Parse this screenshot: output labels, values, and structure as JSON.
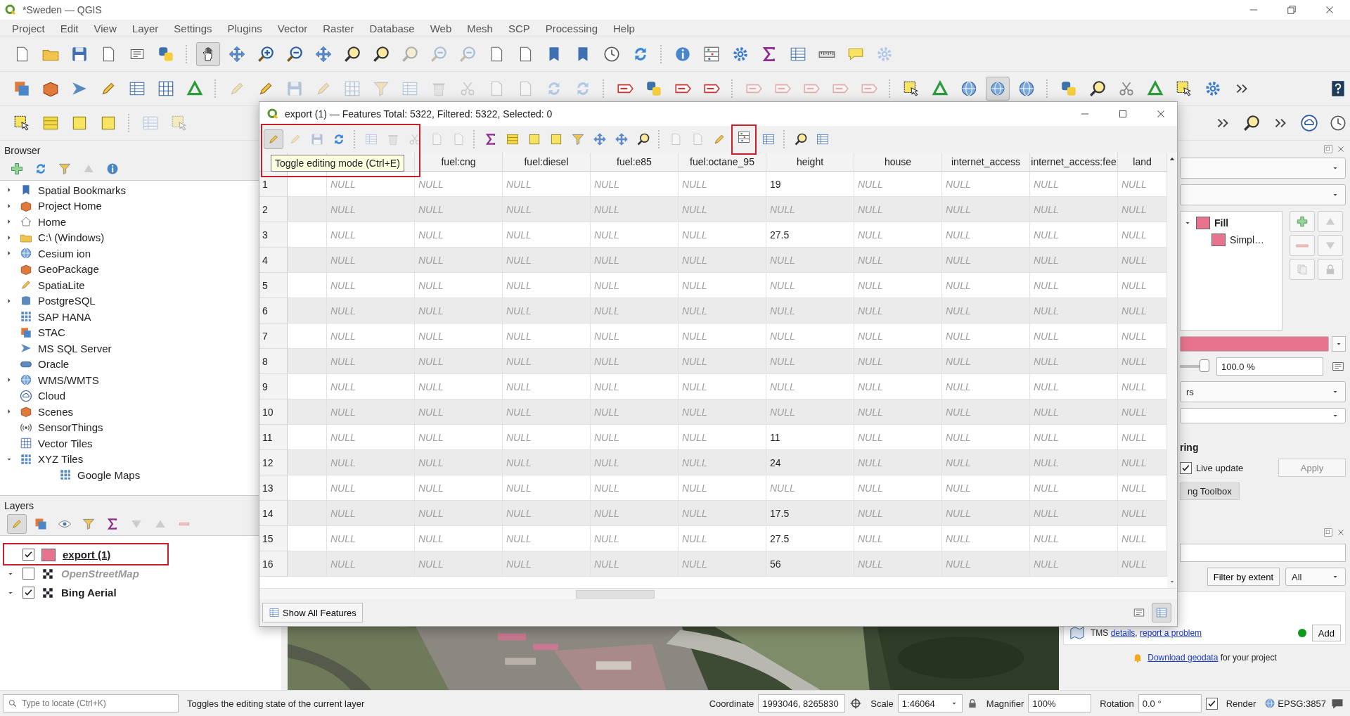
{
  "window": {
    "title": "*Sweden — QGIS"
  },
  "menu": [
    "Project",
    "Edit",
    "View",
    "Layer",
    "Settings",
    "Plugins",
    "Vector",
    "Raster",
    "Database",
    "Web",
    "Mesh",
    "SCP",
    "Processing",
    "Help"
  ],
  "browser": {
    "title": "Browser",
    "items": [
      {
        "label": "Spatial Bookmarks",
        "expandable": true,
        "expanded": false
      },
      {
        "label": "Project Home",
        "expandable": true,
        "expanded": false
      },
      {
        "label": "Home",
        "expandable": true,
        "expanded": false
      },
      {
        "label": "C:\\ (Windows)",
        "expandable": true,
        "expanded": false
      },
      {
        "label": "Cesium ion",
        "expandable": true,
        "expanded": false
      },
      {
        "label": "GeoPackage",
        "expandable": false
      },
      {
        "label": "SpatiaLite",
        "expandable": false
      },
      {
        "label": "PostgreSQL",
        "expandable": true,
        "expanded": false
      },
      {
        "label": "SAP HANA",
        "expandable": false
      },
      {
        "label": "STAC",
        "expandable": false
      },
      {
        "label": "MS SQL Server",
        "expandable": false
      },
      {
        "label": "Oracle",
        "expandable": false
      },
      {
        "label": "WMS/WMTS",
        "expandable": true,
        "expanded": false
      },
      {
        "label": "Cloud",
        "expandable": false
      },
      {
        "label": "Scenes",
        "expandable": true,
        "expanded": false
      },
      {
        "label": "SensorThings",
        "expandable": false
      },
      {
        "label": "Vector Tiles",
        "expandable": false
      },
      {
        "label": "XYZ Tiles",
        "expandable": true,
        "expanded": true,
        "children": [
          {
            "label": "Google Maps"
          }
        ]
      }
    ]
  },
  "layers": {
    "title": "Layers",
    "items": [
      {
        "name": "export (1)",
        "kind": "vector",
        "visible": true,
        "current": true
      },
      {
        "name": "OpenStreetMap",
        "kind": "raster",
        "visible": false,
        "current": false,
        "expanded": true
      },
      {
        "name": "Bing Aerial",
        "kind": "group",
        "visible": true,
        "current": false,
        "expanded": true
      }
    ]
  },
  "attribute_table": {
    "title": "export (1) — Features Total: 5322, Filtered: 5322, Selected: 0",
    "tooltip": "Toggle editing mode (Ctrl+E)",
    "columns": [
      "",
      "fuel:cng",
      "fuel:diesel",
      "fuel:e85",
      "fuel:octane_95",
      "height",
      "house",
      "internet_access",
      "internet_access:fee",
      "land"
    ],
    "rows": [
      {
        "number": "1",
        "cells": [
          "NULL",
          "NULL",
          "NULL",
          "NULL",
          "NULL",
          "19",
          "NULL",
          "NULL",
          "NULL",
          "NULL"
        ]
      },
      {
        "number": "2",
        "cells": [
          "NULL",
          "NULL",
          "NULL",
          "NULL",
          "NULL",
          "NULL",
          "NULL",
          "NULL",
          "NULL",
          "NULL"
        ]
      },
      {
        "number": "3",
        "cells": [
          "NULL",
          "NULL",
          "NULL",
          "NULL",
          "NULL",
          "27.5",
          "NULL",
          "NULL",
          "NULL",
          "NULL"
        ]
      },
      {
        "number": "4",
        "cells": [
          "NULL",
          "NULL",
          "NULL",
          "NULL",
          "NULL",
          "NULL",
          "NULL",
          "NULL",
          "NULL",
          "NULL"
        ]
      },
      {
        "number": "5",
        "cells": [
          "NULL",
          "NULL",
          "NULL",
          "NULL",
          "NULL",
          "NULL",
          "NULL",
          "NULL",
          "NULL",
          "NULL"
        ]
      },
      {
        "number": "6",
        "cells": [
          "NULL",
          "NULL",
          "NULL",
          "NULL",
          "NULL",
          "NULL",
          "NULL",
          "NULL",
          "NULL",
          "NULL"
        ]
      },
      {
        "number": "7",
        "cells": [
          "NULL",
          "NULL",
          "NULL",
          "NULL",
          "NULL",
          "NULL",
          "NULL",
          "NULL",
          "NULL",
          "NULL"
        ]
      },
      {
        "number": "8",
        "cells": [
          "NULL",
          "NULL",
          "NULL",
          "NULL",
          "NULL",
          "NULL",
          "NULL",
          "NULL",
          "NULL",
          "NULL"
        ]
      },
      {
        "number": "9",
        "cells": [
          "NULL",
          "NULL",
          "NULL",
          "NULL",
          "NULL",
          "NULL",
          "NULL",
          "NULL",
          "NULL",
          "NULL"
        ]
      },
      {
        "number": "10",
        "cells": [
          "NULL",
          "NULL",
          "NULL",
          "NULL",
          "NULL",
          "NULL",
          "NULL",
          "NULL",
          "NULL",
          "NULL"
        ]
      },
      {
        "number": "11",
        "cells": [
          "NULL",
          "NULL",
          "NULL",
          "NULL",
          "NULL",
          "11",
          "NULL",
          "NULL",
          "NULL",
          "NULL"
        ]
      },
      {
        "number": "12",
        "cells": [
          "NULL",
          "NULL",
          "NULL",
          "NULL",
          "NULL",
          "24",
          "NULL",
          "NULL",
          "NULL",
          "NULL"
        ]
      },
      {
        "number": "13",
        "cells": [
          "NULL",
          "NULL",
          "NULL",
          "NULL",
          "NULL",
          "NULL",
          "NULL",
          "NULL",
          "NULL",
          "NULL"
        ]
      },
      {
        "number": "14",
        "cells": [
          "NULL",
          "NULL",
          "NULL",
          "NULL",
          "NULL",
          "17.5",
          "NULL",
          "NULL",
          "NULL",
          "NULL"
        ]
      },
      {
        "number": "15",
        "cells": [
          "NULL",
          "NULL",
          "NULL",
          "NULL",
          "NULL",
          "27.5",
          "NULL",
          "NULL",
          "NULL",
          "NULL"
        ]
      },
      {
        "number": "16",
        "cells": [
          "NULL",
          "NULL",
          "NULL",
          "NULL",
          "NULL",
          "56",
          "NULL",
          "NULL",
          "NULL",
          "NULL"
        ]
      }
    ],
    "footer_button": "Show All Features"
  },
  "style_dock": {
    "symbols": [
      {
        "label": "Fill",
        "kind": "symbol",
        "expanded": true
      },
      {
        "label": "Simpl…",
        "kind": "layer"
      }
    ],
    "opacity": {
      "level": 1,
      "value": "100.0 %"
    },
    "blend_value": "rs",
    "section_title": "ring",
    "live_update": {
      "label": "Live update",
      "checked": true
    },
    "apply_button": "Apply",
    "tab": "ng Toolbox"
  },
  "source_dock": {
    "filter_button": "Filter by extent",
    "filter_value": "All",
    "items": [
      {
        "parts": [
          {
            "text": "TMS "
          },
          {
            "link": "details"
          },
          {
            "text": ", "
          },
          {
            "link": "report a problem"
          }
        ],
        "available": true,
        "button": "Add"
      }
    ],
    "notice": [
      {
        "link": "Download geodata"
      },
      {
        "text": " for your project"
      }
    ]
  },
  "status_bar": {
    "locator_placeholder": "Type to locate (Ctrl+K)",
    "message": "Toggles the editing state of the current layer",
    "coordinate_label": "Coordinate",
    "coordinate": "1993046, 8265830",
    "scale_label": "Scale",
    "scale": "1:46064",
    "magnifier_label": "Magnifier",
    "magnifier": "100%",
    "rotation_label": "Rotation",
    "rotation": "0.0 °",
    "render": {
      "label": "Render",
      "checked": true
    },
    "crs": "EPSG:3857"
  }
}
